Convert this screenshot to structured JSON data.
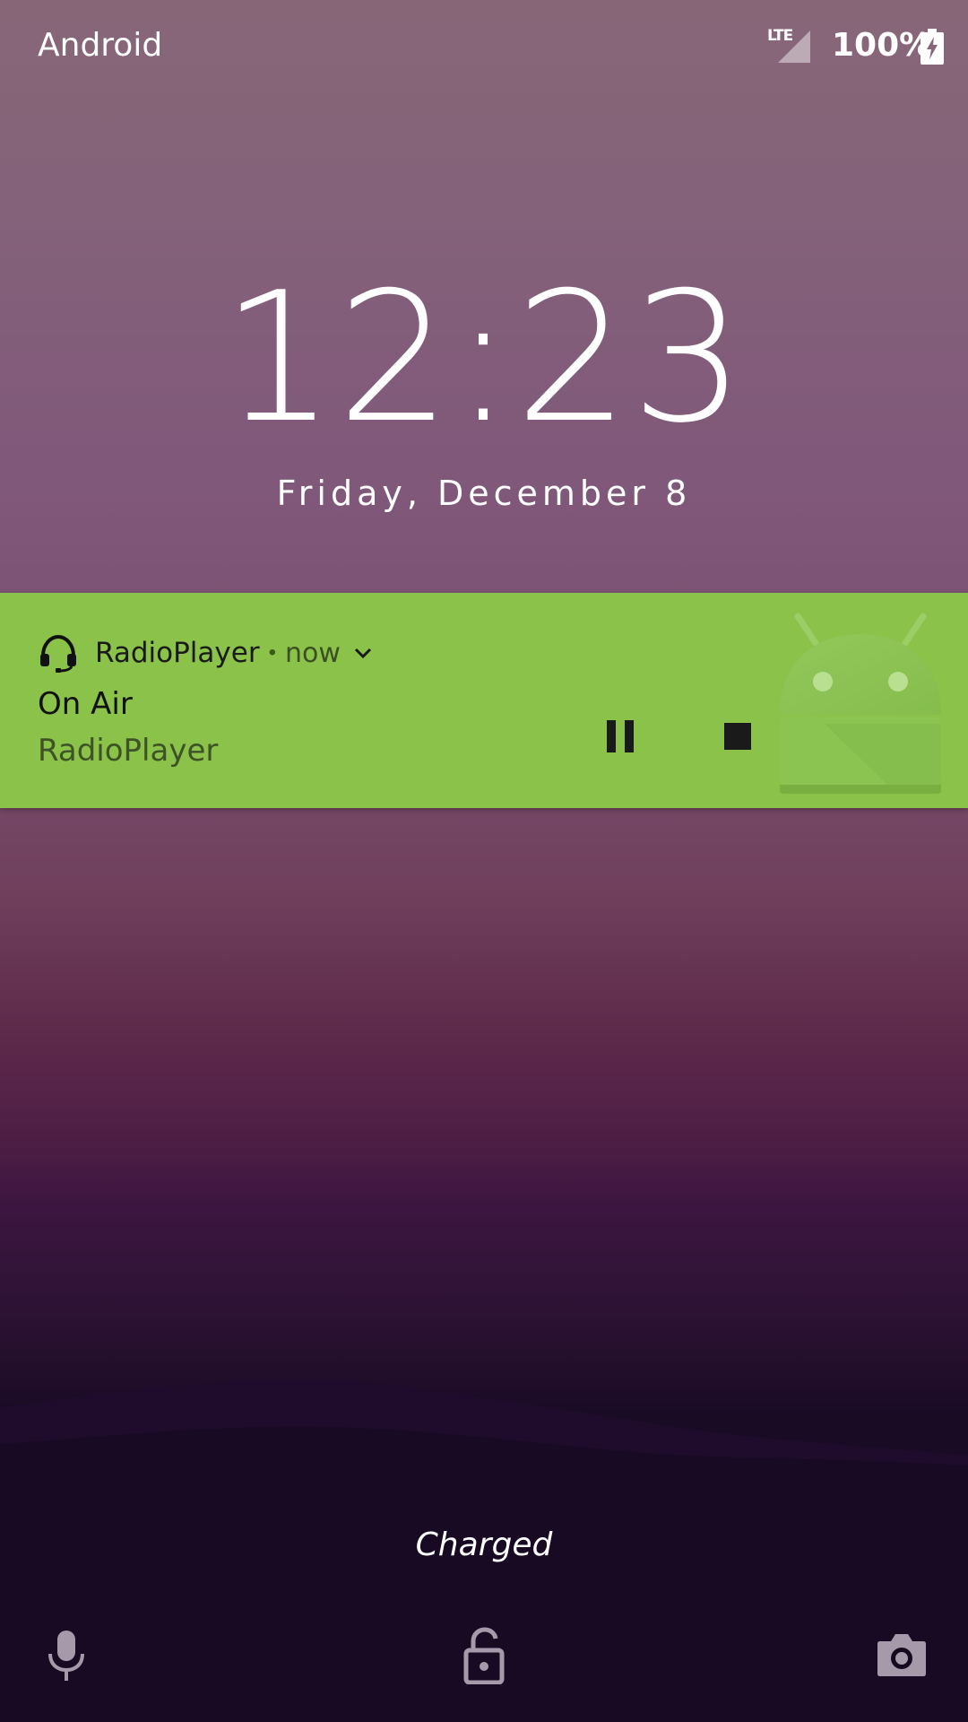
{
  "status_bar": {
    "carrier": "Android",
    "network_type": "LTE",
    "battery_percent": "100%",
    "battery_state": "charging"
  },
  "lockscreen": {
    "time": "12:23",
    "date": "Friday, December 8",
    "charging_status": "Charged"
  },
  "notification": {
    "app_name": "RadioPlayer",
    "separator": "•",
    "time_ago": "now",
    "title": "On Air",
    "text": "RadioPlayer",
    "background_color": "#8bc24a",
    "app_icon": "headset-icon",
    "actions": [
      {
        "icon": "pause-icon"
      },
      {
        "icon": "stop-icon"
      }
    ],
    "large_icon": "android-robot-icon"
  },
  "bottom_shortcuts": {
    "left": "microphone-icon",
    "center": "lock-icon",
    "right": "camera-icon"
  }
}
